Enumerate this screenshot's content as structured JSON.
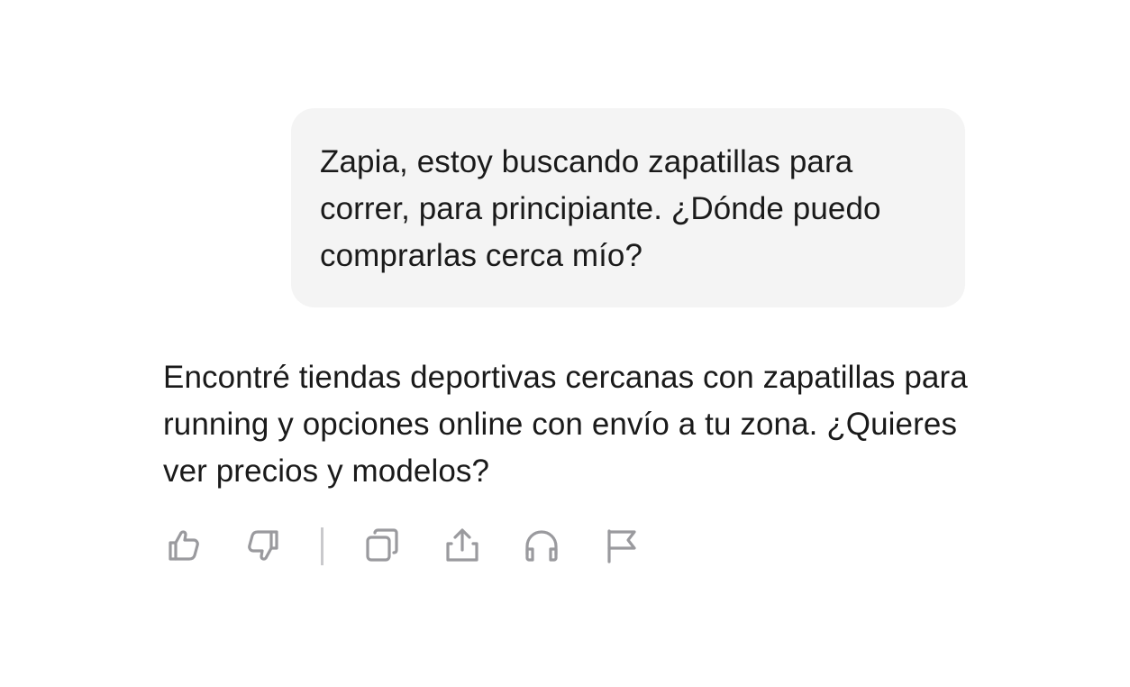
{
  "conversation": {
    "user_message": "Zapia, estoy buscando zapatillas para correr, para principiante. ¿Dónde puedo comprarlas cerca mío?",
    "assistant_message": "Encontré tiendas deportivas cercanas con zapatillas para running y opciones online con envío a tu zona. ¿Quieres ver precios y modelos?"
  },
  "actions": [
    {
      "icon": "thumbs-up-icon"
    },
    {
      "icon": "thumbs-down-icon"
    },
    {
      "icon": "copy-icon"
    },
    {
      "icon": "share-icon"
    },
    {
      "icon": "headphones-icon"
    },
    {
      "icon": "flag-icon"
    }
  ],
  "colors": {
    "user_bubble_bg": "#f4f4f4",
    "text": "#1a1a1a",
    "icon": "#9a9a9e",
    "divider": "#c9c9cc"
  }
}
